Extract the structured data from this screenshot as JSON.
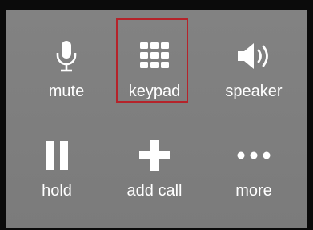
{
  "call_controls": {
    "mute_label": "mute",
    "keypad_label": "keypad",
    "speaker_label": "speaker",
    "hold_label": "hold",
    "add_call_label": "add call",
    "more_label": "more"
  },
  "icons": {
    "mute": "microphone-icon",
    "keypad": "keypad-grid-icon",
    "speaker": "speaker-icon",
    "hold": "pause-icon",
    "add_call": "plus-icon",
    "more": "ellipsis-icon"
  },
  "colors": {
    "panel_background": "#7e7e7e",
    "frame": "#0b0b0b",
    "foreground": "#ffffff",
    "highlight_border": "#b5232a"
  }
}
